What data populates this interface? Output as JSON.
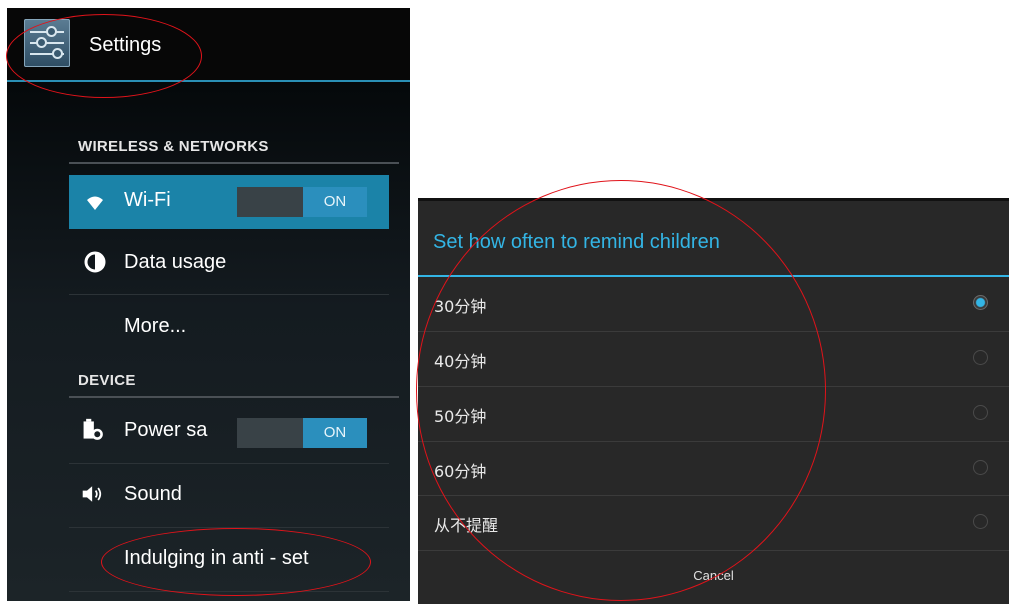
{
  "settings": {
    "title": "Settings",
    "sections": {
      "wireless": "WIRELESS & NETWORKS",
      "device": "DEVICE"
    },
    "items": {
      "wifi": {
        "label": "Wi-Fi",
        "toggle": "ON",
        "icon": "wifi-icon"
      },
      "data_usage": {
        "label": "Data usage",
        "icon": "data-usage-icon"
      },
      "more": {
        "label": "More..."
      },
      "power_saving": {
        "label": "Power sa",
        "toggle": "ON",
        "icon": "battery-settings-icon"
      },
      "sound": {
        "label": "Sound",
        "icon": "speaker-icon"
      },
      "anti_addiction": {
        "label": "Indulging in anti - set"
      }
    }
  },
  "dialog": {
    "title": "Set how often to remind children",
    "options": [
      {
        "label": "30分钟",
        "selected": true
      },
      {
        "label": "40分钟",
        "selected": false
      },
      {
        "label": "50分钟",
        "selected": false
      },
      {
        "label": "60分钟",
        "selected": false
      },
      {
        "label": "从不提醒",
        "selected": false
      }
    ],
    "cancel": "Cancel"
  },
  "colors": {
    "accent": "#33b5e5",
    "wifi_row": "#1b83a8",
    "annotation": "#e0131a"
  }
}
